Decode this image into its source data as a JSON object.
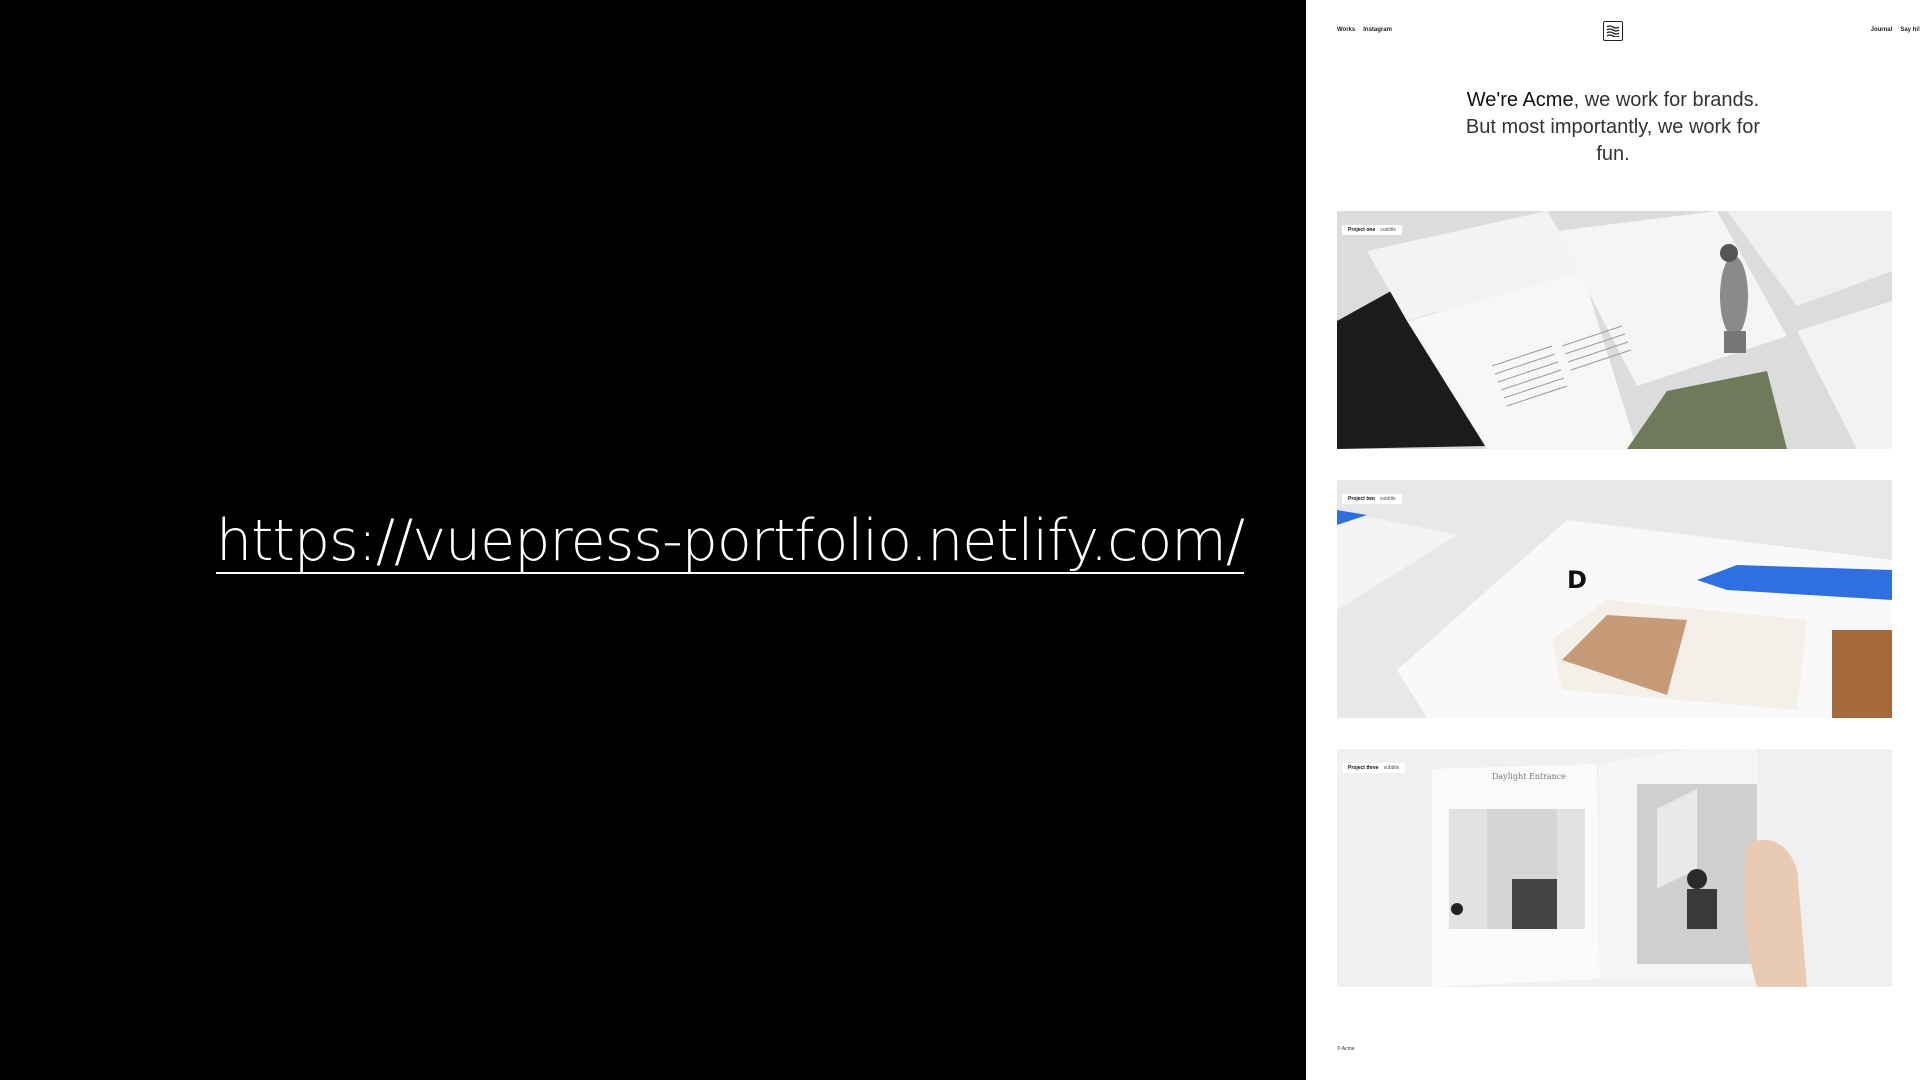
{
  "slide": {
    "url": "https://vuepress-portfolio.netlify.com/"
  },
  "site": {
    "nav": {
      "left": [
        "Works",
        "Instagram"
      ],
      "right": [
        "Journal",
        "Say hi!"
      ]
    },
    "logo_icon": "wave-logo-icon",
    "intro": {
      "brand": "We're Acme",
      "line1_rest": ", we work for brands.",
      "line2": "But most importantly, we work for",
      "line3": "fun."
    },
    "projects": [
      {
        "title": "Project one",
        "subtitle": "subtitle"
      },
      {
        "title": "Project two",
        "subtitle": "subtitle"
      },
      {
        "title": "Project three",
        "subtitle": "subtitle"
      }
    ],
    "project_three_book_heading": "Daylight Entrance",
    "footer": "© Acme"
  },
  "colors": {
    "slide_background": "#000000",
    "site_background": "#ffffff",
    "accent_blue": "#2f6fe0"
  }
}
